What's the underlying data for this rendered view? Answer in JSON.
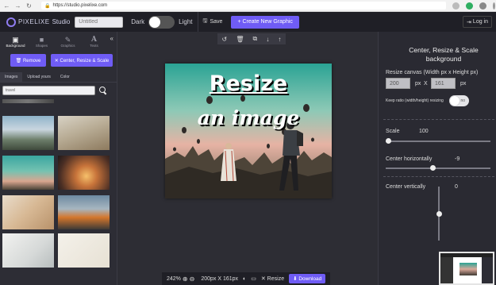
{
  "browser": {
    "url": "https://studio.pixelixe.com",
    "nav": [
      "←",
      "→",
      "↻"
    ]
  },
  "appbar": {
    "logo_text": "PIXELIXE",
    "studio_label": "Studio",
    "title_placeholder": "Untitled",
    "dark_label": "Dark",
    "light_label": "Light",
    "save_label": "Save",
    "create_label": "+ Create New Graphic",
    "login_label": "Log in"
  },
  "sidebar": {
    "tabs": [
      {
        "label": "Background",
        "icon": "image-icon"
      },
      {
        "label": "Shapes",
        "icon": "square-icon"
      },
      {
        "label": "Graphics",
        "icon": "pencil-icon"
      },
      {
        "label": "Texts",
        "icon": "text-icon"
      }
    ],
    "collapse_glyph": "«",
    "remove_label": "🗑 Remove",
    "center_label": "✕ Center, Resize & Scale",
    "subtabs": [
      "Images",
      "Upload yours",
      "Color"
    ],
    "search_value": "travel"
  },
  "toolbar": {
    "icons": [
      "undo-icon",
      "trash-icon",
      "duplicate-icon",
      "arrow-down-icon",
      "arrow-up-icon"
    ],
    "glyphs": [
      "↺",
      "🗑",
      "⧉",
      "↓",
      "↑"
    ]
  },
  "artboard": {
    "line1": "Resize",
    "line2": "an image"
  },
  "bottombar": {
    "zoom": "242%",
    "size": "200px X 161px",
    "resize_label": "✕ Resize",
    "download_label": "⬇ Download"
  },
  "rightpanel": {
    "title": "Center, Resize & Scale background",
    "resize_label": "Resize canvas (Width px x Height px)",
    "width_value": "200",
    "height_value": "161",
    "px1": "px",
    "x_label": "X",
    "px2": "px",
    "keep_ratio_label": "Keep ratio (width/height) resizing",
    "keep_ratio_state": "no",
    "scale_label": "Scale",
    "scale_value": "100",
    "scale_level": 0.0,
    "center_h_label": "Center horizontally",
    "center_h_value": "-9",
    "center_h_level": 0.45,
    "center_v_label": "Center vertically",
    "center_v_value": "0",
    "center_v_level": 0.5
  }
}
